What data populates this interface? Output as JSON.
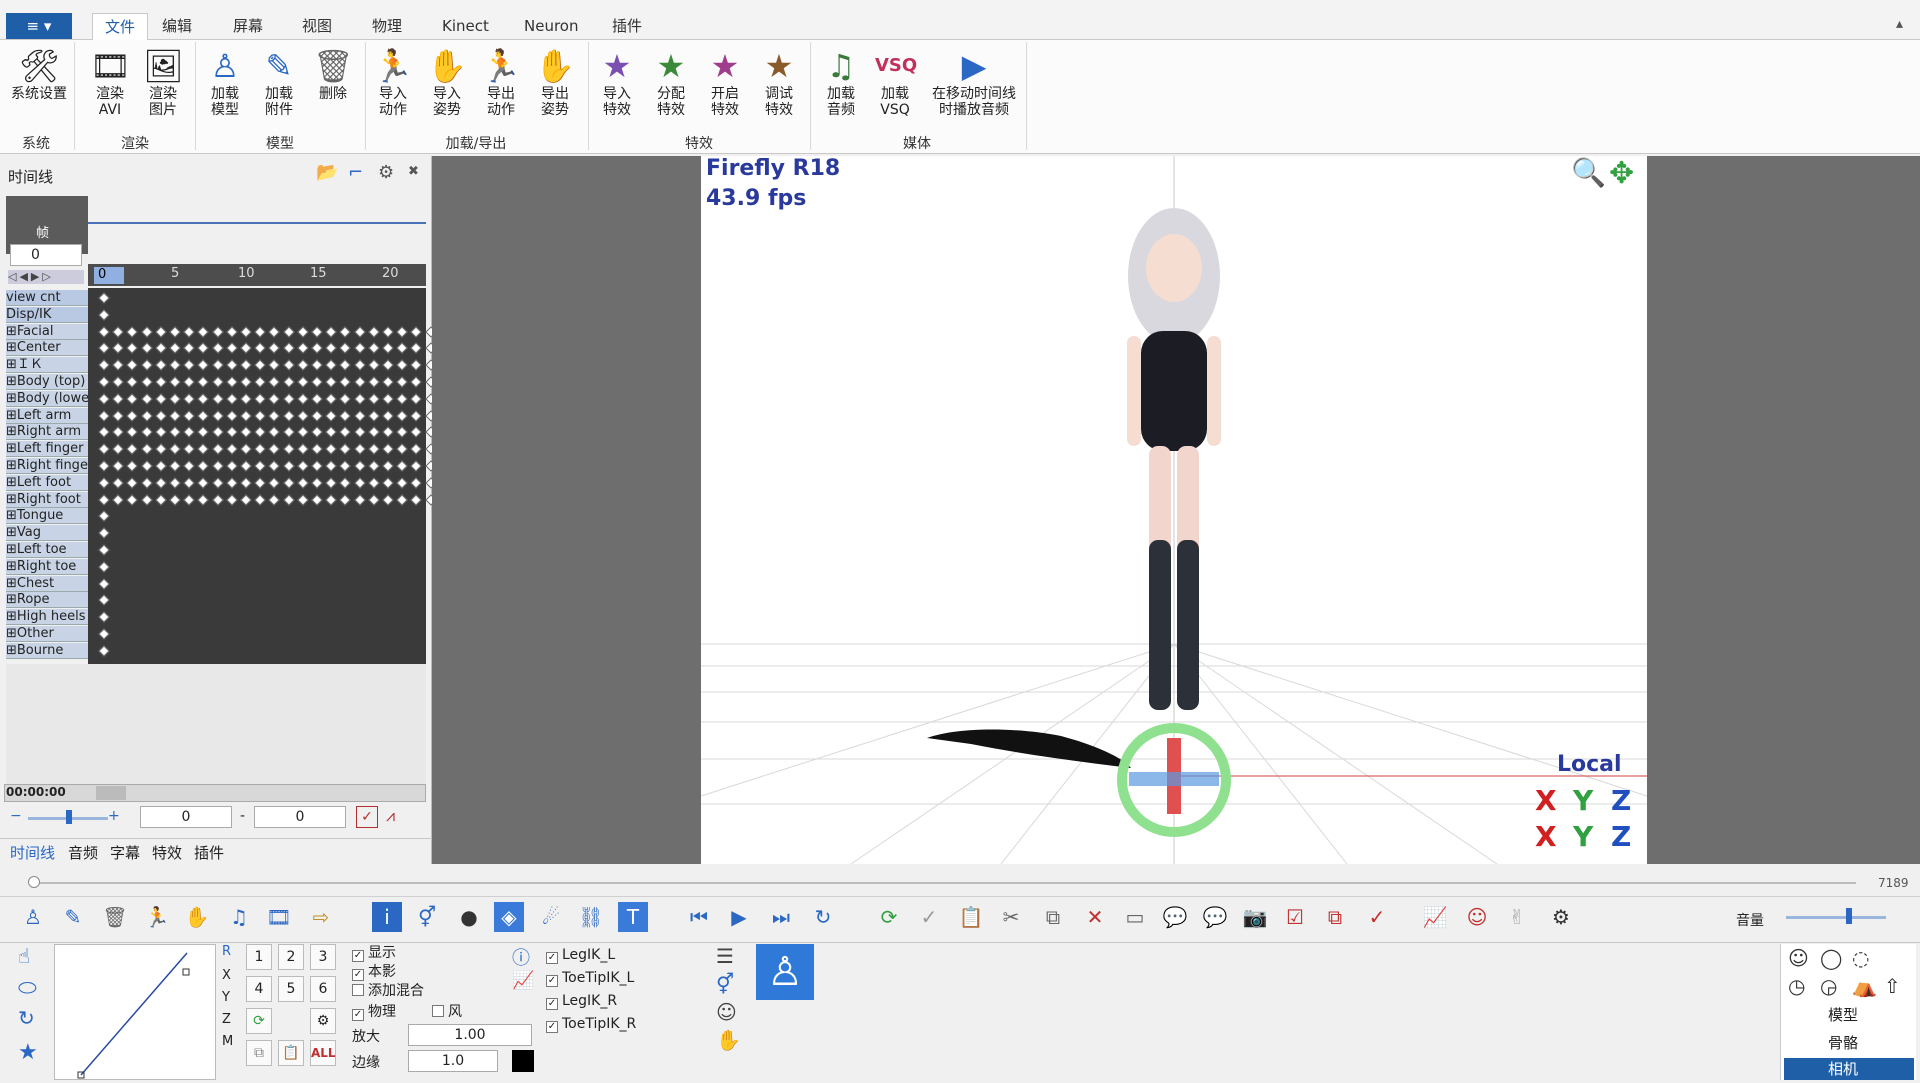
{
  "menu": {
    "file_icon": "≡",
    "tabs": [
      {
        "label": "文件"
      },
      {
        "label": "编辑"
      },
      {
        "label": "屏幕"
      },
      {
        "label": "视图"
      },
      {
        "label": "物理"
      },
      {
        "label": "Kinect"
      },
      {
        "label": "Neuron"
      },
      {
        "label": "插件"
      }
    ],
    "collapse_icon": "▴"
  },
  "ribbon": {
    "buttons": [
      {
        "label": "系统设置",
        "icon": "tools-icon"
      },
      {
        "label": "渲染\nAVI",
        "icon": "render-avi-icon"
      },
      {
        "label": "渲染\n图片",
        "icon": "render-image-icon"
      },
      {
        "label": "加载\n模型",
        "icon": "load-model-icon"
      },
      {
        "label": "加载\n附件",
        "icon": "load-accessory-icon"
      },
      {
        "label": "删除",
        "icon": "trash-icon"
      },
      {
        "label": "导入\n动作",
        "icon": "import-motion-icon"
      },
      {
        "label": "导入\n姿势",
        "icon": "import-pose-icon"
      },
      {
        "label": "导出\n动作",
        "icon": "export-motion-icon"
      },
      {
        "label": "导出\n姿势",
        "icon": "export-pose-icon"
      },
      {
        "label": "导入\n特效",
        "icon": "import-effect-icon"
      },
      {
        "label": "分配\n特效",
        "icon": "assign-effect-icon"
      },
      {
        "label": "开启\n特效",
        "icon": "enable-effect-icon"
      },
      {
        "label": "调试\n特效",
        "icon": "debug-effect-icon"
      },
      {
        "label": "加载\n音频",
        "icon": "load-audio-icon"
      },
      {
        "label": "加载\nVSQ",
        "icon": "load-vsq-icon"
      },
      {
        "label": "在移动时间线\n时播放音频",
        "icon": "play-audio-icon"
      }
    ],
    "groups": [
      "系统",
      "渲染",
      "模型",
      "加载/导出",
      "特效",
      "媒体"
    ]
  },
  "timeline": {
    "title": "时间线",
    "frame_label": "帧",
    "frame_value": "0",
    "ruler": [
      "0",
      "5",
      "10",
      "15",
      "20"
    ],
    "rows": [
      "view cnt",
      "Disp/IK",
      "Facial",
      "Center",
      "ＩＫ",
      "Body (top)",
      "Body (lowe",
      "Left arm",
      "Right arm",
      "Left finger",
      "Right finge",
      "Left foot",
      "Right foot",
      "Tongue",
      "Vag",
      "Left toe",
      "Right toe",
      "Chest",
      "Rope",
      "High heels",
      "Other",
      "Bourne"
    ],
    "time": "00:00:00",
    "range_start": "0",
    "range_sep": "-",
    "range_end": "0",
    "bottom_tabs": [
      "时间线",
      "音频",
      "字幕",
      "特效",
      "插件"
    ]
  },
  "viewport": {
    "title": "Firefly R18",
    "fps": "43.9 fps",
    "mode": "Local",
    "axes": [
      "X",
      "Y",
      "Z"
    ]
  },
  "seek": {
    "total": "7189"
  },
  "volume_label": "音量",
  "bottom": {
    "axis_labels": [
      "R",
      "X",
      "Y",
      "Z",
      "M"
    ],
    "num_buttons": [
      "1",
      "2",
      "3",
      "4",
      "5",
      "6"
    ],
    "all_label": "ALL",
    "checks": [
      {
        "label": "显示",
        "checked": true
      },
      {
        "label": "本影",
        "checked": true
      },
      {
        "label": "添加混合",
        "checked": false
      },
      {
        "label": "物理",
        "checked": true
      },
      {
        "label": "风",
        "checked": false
      }
    ],
    "scale_label": "放大",
    "scale_value": "1.00",
    "edge_label": "边缘",
    "edge_value": "1.0",
    "ik": [
      {
        "label": "LegIK_L",
        "checked": true
      },
      {
        "label": "ToeTipIK_L",
        "checked": true
      },
      {
        "label": "LegIK_R",
        "checked": true
      },
      {
        "label": "ToeTipIK_R",
        "checked": true
      }
    ],
    "right_items": [
      "模型",
      "骨骼",
      "相机"
    ]
  }
}
